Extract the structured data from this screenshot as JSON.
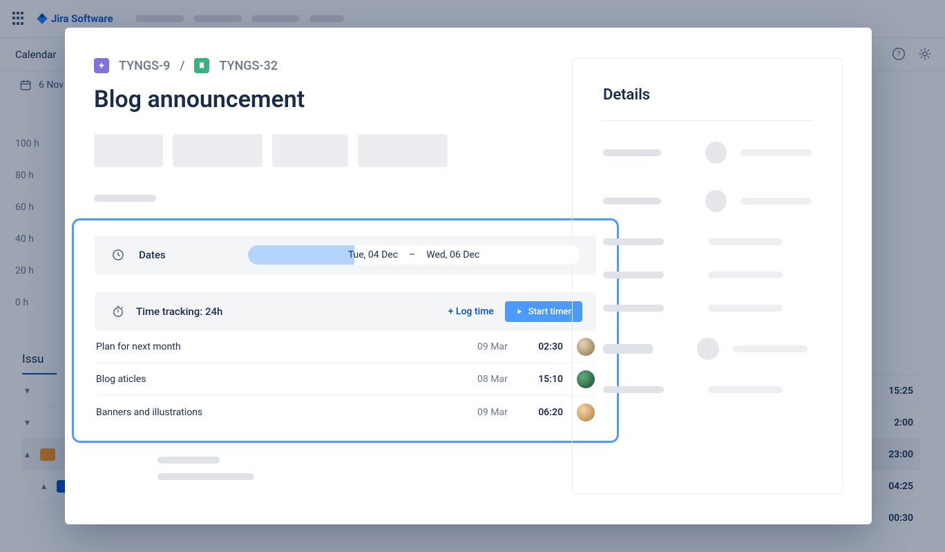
{
  "app": {
    "name": "Jira Software",
    "calendar_tab": "Calendar",
    "date_label": "6 Nov",
    "issues_heading": "Issu"
  },
  "hours": [
    "100 h",
    "80 h",
    "60 h",
    "40 h",
    "20 h",
    "0 h"
  ],
  "background_rows": [
    {
      "time": "15:25"
    },
    {
      "time": "2:00"
    },
    {
      "time": "23:00",
      "highlighted": true
    },
    {
      "time": "04:25"
    },
    {
      "time": "00:30"
    }
  ],
  "crumbs": {
    "parent": "TYNGS-9",
    "sep": "/",
    "key": "TYNGS-32"
  },
  "issue": {
    "title": "Blog announcement"
  },
  "dates": {
    "label": "Dates",
    "start": "Tue, 04 Dec",
    "sep": "–",
    "end": "Wed, 06 Dec"
  },
  "time_tracking": {
    "label_prefix": "Time tracking: ",
    "value": "24h",
    "log_time": "+ Log time",
    "start_timer": "Start timer"
  },
  "logs": [
    {
      "name": "Plan for next month",
      "date": "09 Mar",
      "dur": "02:30",
      "color": "#c0b283"
    },
    {
      "name": "Blog aticles",
      "date": "08 Mar",
      "dur": "15:10",
      "color": "#2a6f47"
    },
    {
      "name": "Banners and illustrations",
      "date": "09 Mar",
      "dur": "06:20",
      "color": "#d9a06b"
    }
  ],
  "side": {
    "title": "Details"
  }
}
